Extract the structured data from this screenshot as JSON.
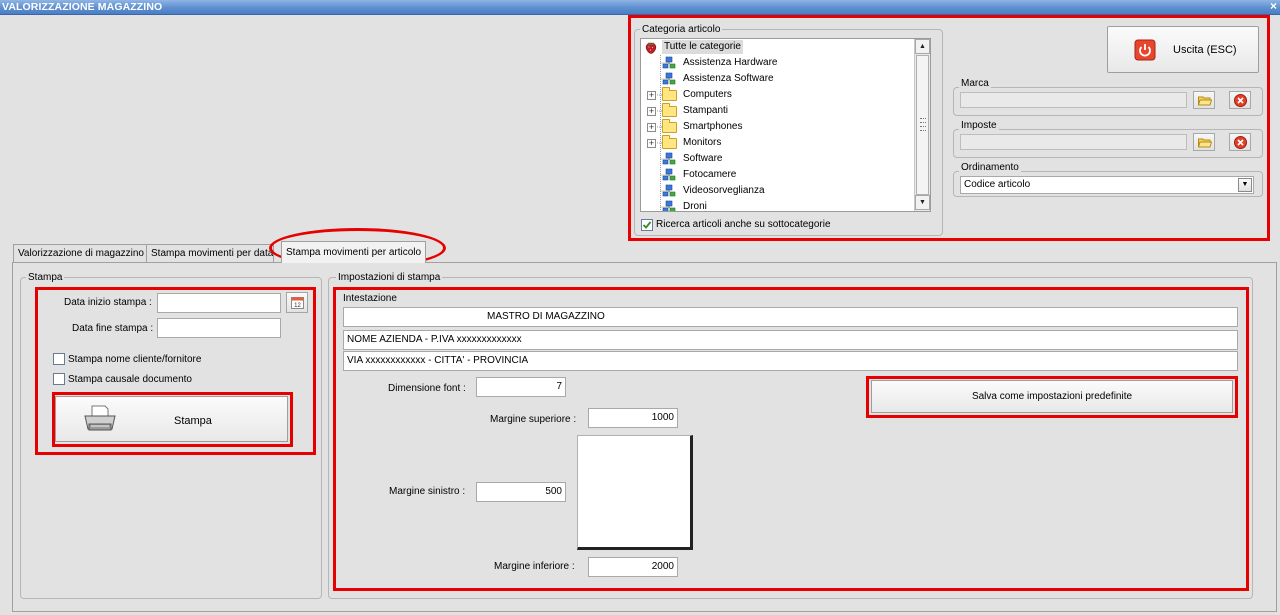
{
  "window": {
    "title": "VALORIZZAZIONE MAGAZZINO",
    "close_glyph": "×"
  },
  "categoria": {
    "group_label": "Categoria articolo",
    "tree_items": [
      {
        "label": "Tutte le categorie",
        "icon": "strawberry-icon",
        "expander": ""
      },
      {
        "label": "Assistenza Hardware",
        "icon": "network-node-icon",
        "expander": ""
      },
      {
        "label": "Assistenza Software",
        "icon": "network-node-icon",
        "expander": ""
      },
      {
        "label": "Computers",
        "icon": "folder-icon",
        "expander": "+"
      },
      {
        "label": "Stampanti",
        "icon": "folder-icon",
        "expander": "+"
      },
      {
        "label": "Smartphones",
        "icon": "folder-icon",
        "expander": "+"
      },
      {
        "label": "Monitors",
        "icon": "folder-icon",
        "expander": "+"
      },
      {
        "label": "Software",
        "icon": "network-node-icon",
        "expander": ""
      },
      {
        "label": "Fotocamere",
        "icon": "network-node-icon",
        "expander": ""
      },
      {
        "label": "Videosorveglianza",
        "icon": "network-node-icon",
        "expander": ""
      },
      {
        "label": "Droni",
        "icon": "network-node-icon",
        "expander": ""
      }
    ],
    "subcategories_checkbox_label": "Ricerca articoli anche su sottocategorie",
    "subcategories_checked": true
  },
  "exit_button": {
    "label": "Uscita (ESC)"
  },
  "marca": {
    "group_label": "Marca",
    "value": ""
  },
  "imposte": {
    "group_label": "Imposte",
    "value": ""
  },
  "ordinamento": {
    "group_label": "Ordinamento",
    "selected": "Codice articolo"
  },
  "tabs": [
    {
      "label": "Valorizzazione di magazzino",
      "active": false
    },
    {
      "label": "Stampa movimenti per data",
      "active": false
    },
    {
      "label": "Stampa movimenti per articolo",
      "active": true
    }
  ],
  "stampa": {
    "group_label": "Stampa",
    "data_inizio_label": "Data inizio stampa :",
    "data_inizio_value": "",
    "data_fine_label": "Data fine stampa :",
    "data_fine_value": "",
    "chk_cliente_label": "Stampa nome cliente/fornitore",
    "chk_causale_label": "Stampa causale documento",
    "print_button_label": "Stampa"
  },
  "impostazioni": {
    "group_label": "Impostazioni di stampa",
    "intestazione_label": "Intestazione",
    "intestazione_line1": "MASTRO DI MAGAZZINO",
    "intestazione_line2": "NOME AZIENDA - P.IVA xxxxxxxxxxxxx",
    "intestazione_line3": "VIA xxxxxxxxxxxx - CITTA' - PROVINCIA",
    "dimensione_font_label": "Dimensione font :",
    "dimensione_font_value": "7",
    "margine_superiore_label": "Margine superiore :",
    "margine_superiore_value": "1000",
    "margine_sinistro_label": "Margine sinistro :",
    "margine_sinistro_value": "500",
    "margine_inferiore_label": "Margine inferiore :",
    "margine_inferiore_value": "2000",
    "save_defaults_label": "Salva come impostazioni predefinite"
  }
}
